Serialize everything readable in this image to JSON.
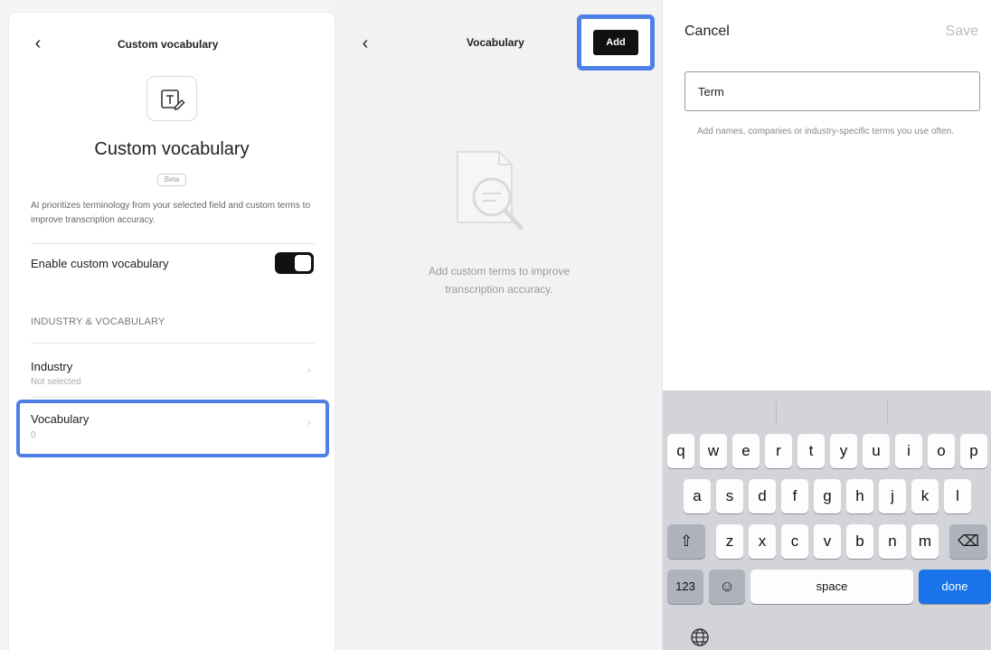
{
  "screen1": {
    "back_glyph": "‹",
    "header_title": "Custom vocabulary",
    "icon": "text-edit-icon",
    "title": "Custom vocabulary",
    "badge": "Beta",
    "description": "AI prioritizes terminology from your selected field and custom terms to improve transcription accuracy.",
    "enable_label": "Enable custom vocabulary",
    "enable_state": true,
    "section_header": "INDUSTRY & VOCABULARY",
    "industry": {
      "label": "Industry",
      "value": "Not selected"
    },
    "vocabulary": {
      "label": "Vocabulary",
      "value": "0"
    },
    "chevron_glyph": "›"
  },
  "screen2": {
    "back_glyph": "‹",
    "header_title": "Vocabulary",
    "add_label": "Add",
    "empty_icon": "document-search-icon",
    "empty_text": "Add custom terms to improve transcription accuracy."
  },
  "screen3": {
    "cancel_label": "Cancel",
    "save_label": "Save",
    "term_placeholder": "Term",
    "hint": "Add names, companies or industry-specific terms you use often.",
    "keyboard": {
      "row1": [
        "q",
        "w",
        "e",
        "r",
        "t",
        "y",
        "u",
        "i",
        "o",
        "p"
      ],
      "row2": [
        "a",
        "s",
        "d",
        "f",
        "g",
        "h",
        "j",
        "k",
        "l"
      ],
      "row3": [
        "z",
        "x",
        "c",
        "v",
        "b",
        "n",
        "m"
      ],
      "shift_glyph": "⇧",
      "delete_glyph": "⌫",
      "numbers_label": "123",
      "emoji_glyph": "☺",
      "space_label": "space",
      "done_label": "done",
      "globe_icon": "globe-icon"
    }
  },
  "colors": {
    "highlight": "#4f7fe8",
    "done_key": "#1a73e8",
    "keyboard_bg": "#d2d4d9"
  }
}
